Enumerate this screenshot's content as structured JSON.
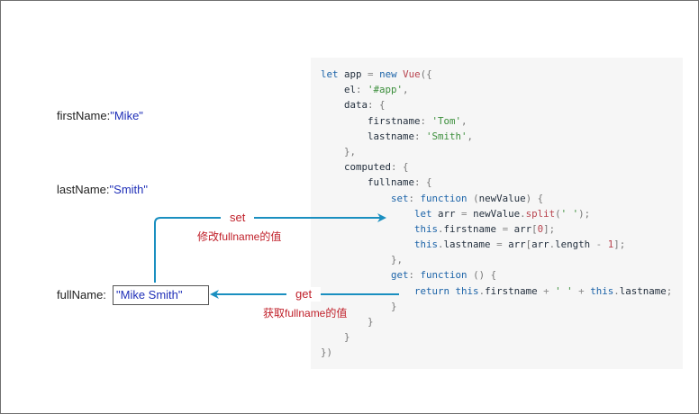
{
  "labels": {
    "firstname_key": "firstName:",
    "firstname_val": "\"Mike\"",
    "lastname_key": "lastName:",
    "lastname_val": "\"Smith\"",
    "fullname_key": "fullName:",
    "fullname_input": "\"Mike Smith\""
  },
  "arrows": {
    "set_label": "set",
    "set_note": "修改fullname的值",
    "get_label": "get",
    "get_note": "获取fullname的值"
  },
  "code": [
    [
      [
        "kw",
        "let"
      ],
      [
        "t",
        " app "
      ],
      [
        "op",
        "="
      ],
      [
        "t",
        " "
      ],
      [
        "kw",
        "new"
      ],
      [
        "t",
        " "
      ],
      [
        "id",
        "Vue"
      ],
      [
        "punc",
        "({"
      ]
    ],
    [
      [
        "t",
        "    el"
      ],
      [
        "punc",
        ": "
      ],
      [
        "str",
        "'#app'"
      ],
      [
        "punc",
        ","
      ]
    ],
    [
      [
        "t",
        "    data"
      ],
      [
        "punc",
        ": {"
      ]
    ],
    [
      [
        "t",
        "        firstname"
      ],
      [
        "punc",
        ": "
      ],
      [
        "str",
        "'Tom'"
      ],
      [
        "punc",
        ","
      ]
    ],
    [
      [
        "t",
        "        lastname"
      ],
      [
        "punc",
        ": "
      ],
      [
        "str",
        "'Smith'"
      ],
      [
        "punc",
        ","
      ]
    ],
    [
      [
        "punc",
        "    },"
      ]
    ],
    [
      [
        "t",
        "    computed"
      ],
      [
        "punc",
        ": {"
      ]
    ],
    [
      [
        "t",
        "        fullname"
      ],
      [
        "punc",
        ": {"
      ]
    ],
    [
      [
        "t",
        "            "
      ],
      [
        "kw",
        "set"
      ],
      [
        "punc",
        ": "
      ],
      [
        "kw",
        "function"
      ],
      [
        "t",
        " "
      ],
      [
        "punc",
        "("
      ],
      [
        "t",
        "newValue"
      ],
      [
        "punc",
        ") {"
      ]
    ],
    [
      [
        "t",
        "                "
      ],
      [
        "kw",
        "let"
      ],
      [
        "t",
        " arr "
      ],
      [
        "op",
        "="
      ],
      [
        "t",
        " newValue"
      ],
      [
        "punc",
        "."
      ],
      [
        "id",
        "split"
      ],
      [
        "punc",
        "("
      ],
      [
        "str",
        "' '"
      ],
      [
        "punc",
        ");"
      ]
    ],
    [
      [
        "t",
        "                "
      ],
      [
        "kw",
        "this"
      ],
      [
        "punc",
        "."
      ],
      [
        "t",
        "firstname "
      ],
      [
        "op",
        "="
      ],
      [
        "t",
        " arr"
      ],
      [
        "punc",
        "["
      ],
      [
        "num",
        "0"
      ],
      [
        "punc",
        "];"
      ]
    ],
    [
      [
        "t",
        "                "
      ],
      [
        "kw",
        "this"
      ],
      [
        "punc",
        "."
      ],
      [
        "t",
        "lastname "
      ],
      [
        "op",
        "="
      ],
      [
        "t",
        " arr"
      ],
      [
        "punc",
        "["
      ],
      [
        "t",
        "arr"
      ],
      [
        "punc",
        "."
      ],
      [
        "t",
        "length "
      ],
      [
        "op",
        "-"
      ],
      [
        "t",
        " "
      ],
      [
        "num",
        "1"
      ],
      [
        "punc",
        "];"
      ]
    ],
    [
      [
        "punc",
        "            },"
      ]
    ],
    [
      [
        "t",
        "            "
      ],
      [
        "kw",
        "get"
      ],
      [
        "punc",
        ": "
      ],
      [
        "kw",
        "function"
      ],
      [
        "t",
        " "
      ],
      [
        "punc",
        "() {"
      ]
    ],
    [
      [
        "t",
        "                "
      ],
      [
        "kw",
        "return"
      ],
      [
        "t",
        " "
      ],
      [
        "kw",
        "this"
      ],
      [
        "punc",
        "."
      ],
      [
        "t",
        "firstname "
      ],
      [
        "op",
        "+"
      ],
      [
        "t",
        " "
      ],
      [
        "str",
        "' '"
      ],
      [
        "t",
        " "
      ],
      [
        "op",
        "+"
      ],
      [
        "t",
        " "
      ],
      [
        "kw",
        "this"
      ],
      [
        "punc",
        "."
      ],
      [
        "t",
        "lastname"
      ],
      [
        "punc",
        ";"
      ]
    ],
    [
      [
        "punc",
        "            }"
      ]
    ],
    [
      [
        "punc",
        "        }"
      ]
    ],
    [
      [
        "punc",
        "    }"
      ]
    ],
    [
      [
        "punc",
        "})"
      ]
    ]
  ],
  "colors": {
    "arrow": "#1a8fc0",
    "note": "#c0202a",
    "value": "#1f2fb8",
    "code_bg": "#f6f6f6"
  }
}
